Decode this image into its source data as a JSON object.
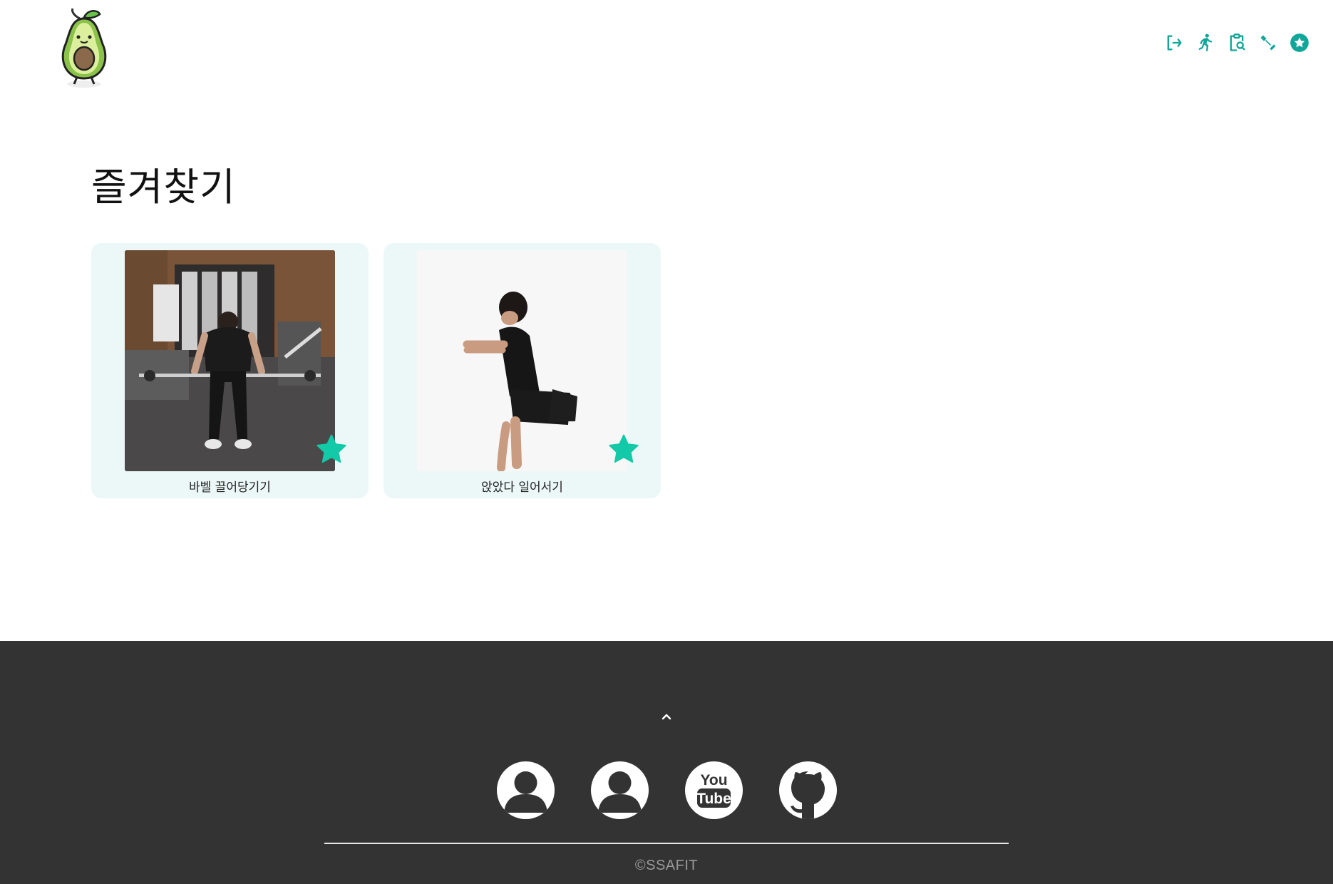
{
  "header": {
    "logo_name": "avocado-mascot",
    "nav": [
      {
        "name": "logout-icon"
      },
      {
        "name": "running-icon"
      },
      {
        "name": "clipboard-search-icon"
      },
      {
        "name": "dumbbell-icon"
      },
      {
        "name": "star-circle-icon"
      }
    ],
    "accent_color": "#11a69a"
  },
  "main": {
    "title": "즐겨찾기",
    "cards": [
      {
        "title": "바벨 끌어당기기",
        "favorited": true
      },
      {
        "title": "앉았다 일어서기",
        "favorited": true
      }
    ],
    "card_bg": "#ecf8f7",
    "star_color": "#12c9a8"
  },
  "footer": {
    "bg": "#333333",
    "scroll_top_icon": "chevron-up-icon",
    "social": [
      {
        "name": "profile-avatar-1-icon"
      },
      {
        "name": "profile-avatar-2-icon"
      },
      {
        "name": "youtube-icon",
        "text_top": "You",
        "text_bottom": "Tube"
      },
      {
        "name": "github-icon"
      }
    ],
    "copyright": "©SSAFIT"
  }
}
